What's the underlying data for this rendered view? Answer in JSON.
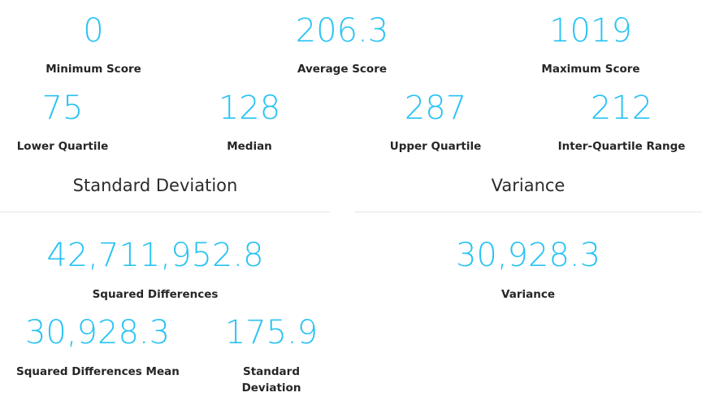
{
  "summary": {
    "minimum": {
      "value": "0",
      "label": "Minimum Score"
    },
    "average": {
      "value": "206.3",
      "label": "Average Score"
    },
    "maximum": {
      "value": "1019",
      "label": "Maximum Score"
    },
    "lower_quartile": {
      "value": "75",
      "label": "Lower Quartile"
    },
    "median": {
      "value": "128",
      "label": "Median"
    },
    "upper_quartile": {
      "value": "287",
      "label": "Upper Quartile"
    },
    "iqr": {
      "value": "212",
      "label": "Inter-Quartile Range"
    }
  },
  "standard_deviation": {
    "title": "Standard Deviation",
    "squared_differences": {
      "value": "42,711,952.8",
      "label": "Squared Differences"
    },
    "squared_differences_mean": {
      "value": "30,928.3",
      "label": "Squared Differences Mean"
    },
    "standard_deviation": {
      "value": "175.9",
      "label": "Standard Deviation"
    }
  },
  "variance": {
    "title": "Variance",
    "variance": {
      "value": "30,928.3",
      "label": "Variance"
    }
  },
  "colors": {
    "value_accent": "#29c3f3",
    "label_text": "#262626",
    "divider": "#e6e6e6"
  }
}
